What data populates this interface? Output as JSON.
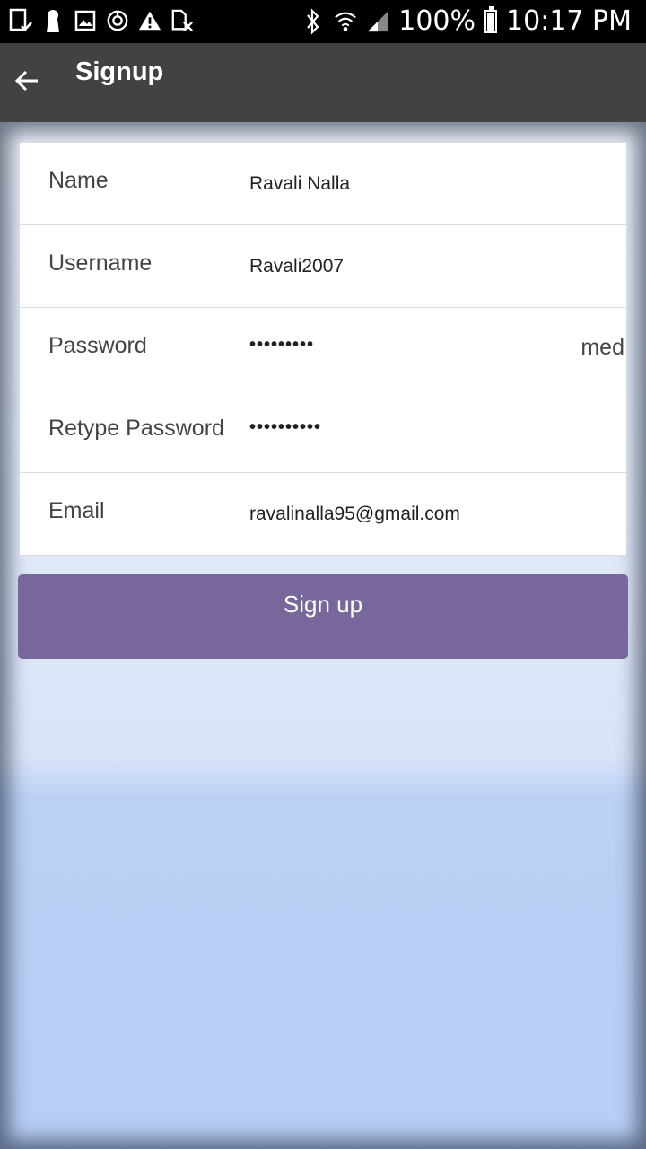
{
  "status_bar": {
    "icons_left": [
      "tablet-check-icon",
      "keyhole-icon",
      "image-icon",
      "timer-icon",
      "warning-icon",
      "no-sim-icon"
    ],
    "battery_percent": "100%",
    "time": "10:17 PM"
  },
  "app_bar": {
    "title": "Signup"
  },
  "form": {
    "name": {
      "label": "Name",
      "value": "Ravali Nalla"
    },
    "username": {
      "label": "Username",
      "value": "Ravali2007"
    },
    "password": {
      "label": "Password",
      "value": "•••••••••",
      "strength": "med"
    },
    "retype_password": {
      "label": "Retype Password",
      "value": "••••••••••"
    },
    "email": {
      "label": "Email",
      "value": "ravalinalla95@gmail.com"
    }
  },
  "signup_button": {
    "label": "Sign up"
  },
  "colors": {
    "app_bar": "#424242",
    "button": "#78679a",
    "background": "#b9d0f5"
  }
}
